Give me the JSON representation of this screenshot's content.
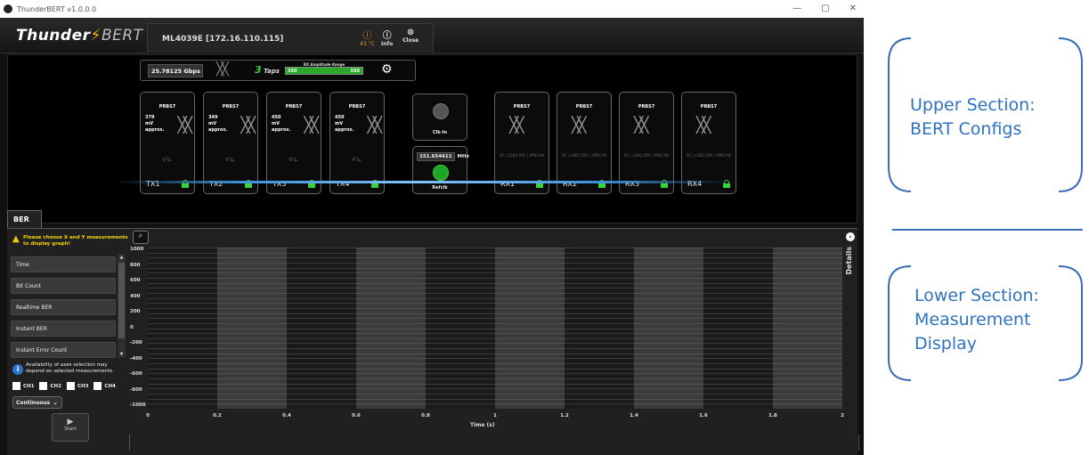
{
  "window": {
    "title": "ThunderBERT v1.0.0.0",
    "minimize": "—",
    "maximize": "▢",
    "close": "✕"
  },
  "header": {
    "logo_thunder": "Thunder",
    "logo_bolt": "⚡",
    "logo_bert": "BERT",
    "device": "ML4039E  [172.16.110.115]",
    "temperature": "43 °C",
    "info_label": "Info",
    "close_label": "Close"
  },
  "config": {
    "data_rate": "25.78125  Gbps",
    "taps_count": "3",
    "taps_label": "Taps",
    "rx_range_label": "RX Amplitude Range",
    "rx_range_min": "350",
    "rx_range_max": "550",
    "tx": [
      {
        "name": "TX1",
        "pattern": "PRBS7",
        "amp1": "379",
        "amp2": "mV",
        "amp3": "approx."
      },
      {
        "name": "TX2",
        "pattern": "PRBS7",
        "amp1": "349",
        "amp2": "mV",
        "amp3": "approx."
      },
      {
        "name": "TX3",
        "pattern": "PRBS7",
        "amp1": "450",
        "amp2": "mV",
        "amp3": "approx."
      },
      {
        "name": "TX4",
        "pattern": "PRBS7",
        "amp1": "450",
        "amp2": "mV",
        "amp3": "approx."
      }
    ],
    "rx": [
      {
        "name": "RX1",
        "pattern": "PRBS7",
        "opts": "BC | LDEQ  DFE | HPECAN"
      },
      {
        "name": "RX2",
        "pattern": "PRBS7",
        "opts": "BC | LDEQ  DFE | HPECAN"
      },
      {
        "name": "RX3",
        "pattern": "PRBS7",
        "opts": "BC | LDEQ  DFE | HPECAN"
      },
      {
        "name": "RX4",
        "pattern": "PRBS7",
        "opts": "BC | LDEQ  DFE | HPECAN"
      }
    ],
    "clk_in_label": "Clk-In",
    "ref_freq": "151.654411",
    "ref_unit": "MHz",
    "refclk_label": "Refclk"
  },
  "ber_tab": "BER",
  "sidebar": {
    "warning": "Please choose X and Y measurements to display graph!",
    "measurements": [
      "Time",
      "Bit Count",
      "Realtime BER",
      "Instant BER",
      "Instant Error Count"
    ],
    "note": "Availability of axes selection may depend on selected measurements.",
    "channels": [
      "CH1",
      "CH2",
      "CH3",
      "CH4"
    ],
    "mode": "Continuous",
    "start_label": "Start"
  },
  "chart_data": {
    "type": "line",
    "title": "",
    "xlabel": "Time (s)",
    "ylabel": "",
    "xlim": [
      0,
      2
    ],
    "ylim": [
      -1000,
      1000
    ],
    "x_ticks": [
      "0",
      "0.2",
      "0.4",
      "0.6",
      "0.8",
      "1",
      "1.2",
      "1.4",
      "1.6",
      "1.8",
      "2"
    ],
    "y_ticks": [
      "1000",
      "800",
      "600",
      "400",
      "200",
      "0",
      "-200",
      "-400",
      "-600",
      "-800",
      "-1000"
    ],
    "series": [],
    "grid": true
  },
  "details_label": "Details",
  "annotations": {
    "upper_1": "Upper Section:",
    "upper_2": "BERT Configs",
    "lower_1": "Lower Section:",
    "lower_2": "Measurement",
    "lower_3": "Display"
  },
  "colors": {
    "accent": "#3ad33a",
    "warning": "#f3d200",
    "annotation": "#2e72c0"
  }
}
